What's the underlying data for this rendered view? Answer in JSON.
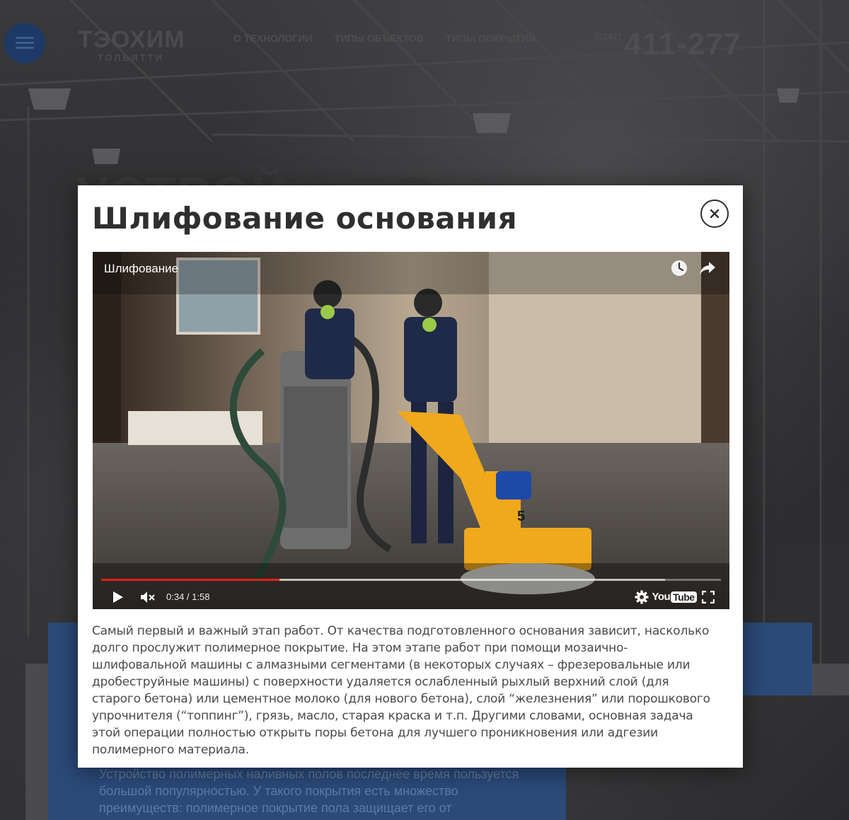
{
  "header": {
    "menu_icon": "hamburger-icon",
    "logo_main": "ТЭОХИМ",
    "logo_sub": "ТОЛЬЯТТИ",
    "nav": [
      "О ТЕХНОЛОГИИ",
      "ТИПЫ ОБЪЕКТОВ",
      "ТИПЫ ПОКРЫТИЙ"
    ],
    "phone_code": "(8242)",
    "phone_number": "411-277"
  },
  "background": {
    "heading": "УСТРОЙСТВО",
    "paragraph": "Устройство полимерных наливных полов последнее время пользуется большой популярностью. У такого покрытия есть множество преимуществ: полимерное покрытие пола защищает его от"
  },
  "modal": {
    "title": "Шлифование основания",
    "close_icon": "close-icon",
    "video": {
      "title": "Шлифование",
      "watch_later_icon": "clock-icon",
      "share_icon": "share-icon",
      "current_time": "0:34",
      "duration": "1:58",
      "time_display": "0:34 / 1:58",
      "progress_fraction": 0.288,
      "buffered_fraction": 0.91,
      "play_icon": "play-icon",
      "mute_icon": "volume-muted-icon",
      "settings_icon": "gear-icon",
      "youtube_you": "You",
      "youtube_tube": "Tube",
      "fullscreen_icon": "fullscreen-icon",
      "accent_color": "#e62117"
    },
    "description": "Самый первый и важный этап работ. От качества подготовленного основания зависит, насколько долго прослужит полимерное покрытие. На этом этапе работ при помощи мозаично-шлифовальной машины с алмазными сегментами (в некоторых случаях – фрезеровальные или дробеструйные машины) с поверхности удаляется ослабленный рыхлый верхний слой (для старого бетона) или цементное молоко (для нового бетона), слой “железнения” или порошкового упрочнителя (“топпинг”), грязь, масло, старая краска и т.п.  Другими словами, основная задача этой операции полностью открыть поры бетона для лучшего проникновения или адгезии полимерного материала."
  },
  "colors": {
    "brand_blue": "#1d3a66",
    "modal_bg": "#ffffff",
    "text_dark": "#2f2f31"
  }
}
